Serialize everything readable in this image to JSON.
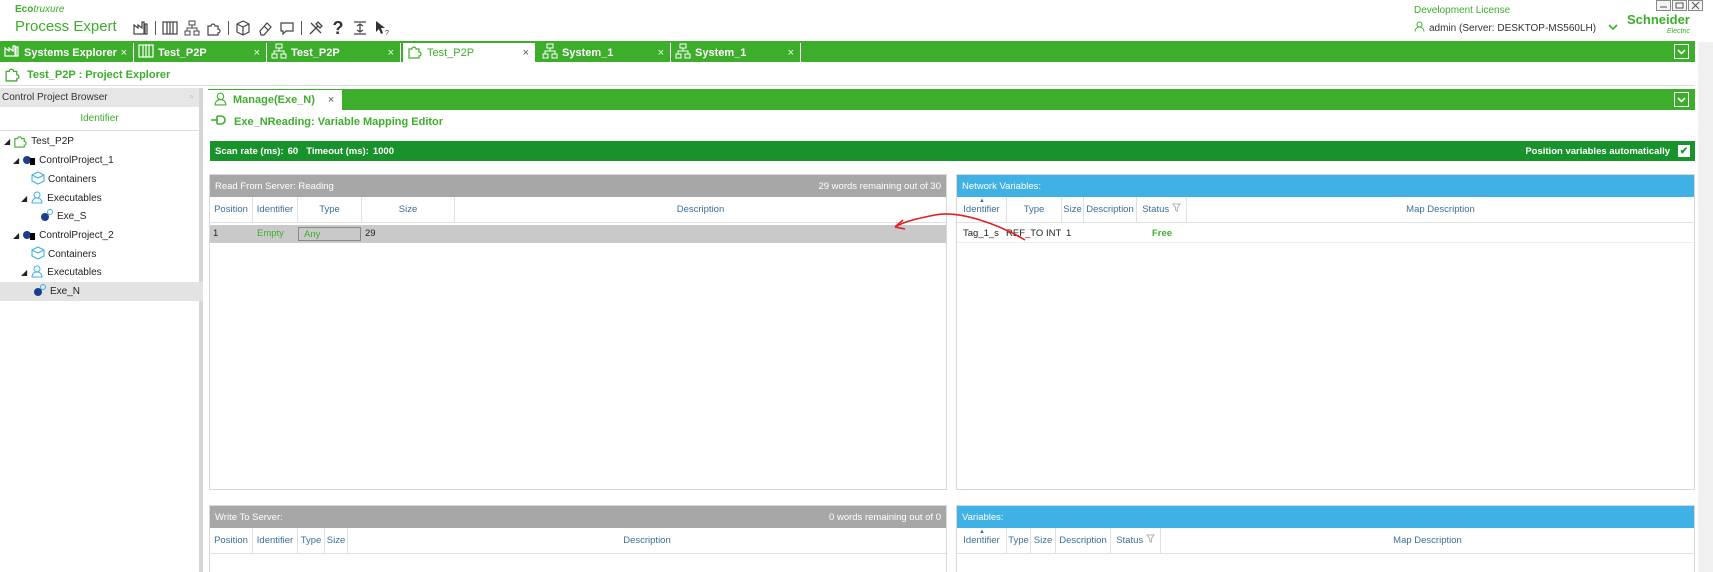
{
  "app": {
    "brand_top": "Eco",
    "brand_top_italic": "truxure",
    "brand_name": "Process Expert",
    "license": "Development License",
    "user": "admin (Server: DESKTOP-MS560LH)",
    "logo_main": "Schneider",
    "logo_sub": "Electric",
    "brand_color": "#3dae2b"
  },
  "toolbar": {
    "icons": [
      "factory-icon",
      "library-icon",
      "network-icon",
      "puzzle-icon",
      "cube-icon",
      "eraser-icon",
      "chat-icon",
      "tools-icon",
      "help-icon",
      "import-export-icon",
      "pointer-help-icon"
    ]
  },
  "tabs": [
    {
      "label": "Systems Explorer",
      "close": "×",
      "icon": "factory-icon"
    },
    {
      "label": "Test_P2P",
      "close": "×",
      "icon": "library-icon"
    },
    {
      "label": "Test_P2P",
      "close": "×",
      "icon": "network-icon"
    },
    {
      "label": "Test_P2P",
      "close": "×",
      "icon": "puzzle-icon"
    },
    {
      "label": "System_1",
      "close": "×",
      "icon": "network-icon"
    },
    {
      "label": "System_1",
      "close": "×",
      "icon": "network-icon"
    }
  ],
  "project_header": "Test_P2P : Project Explorer",
  "browser": {
    "title": "Control Project Browser",
    "column": "Identifier",
    "tree": [
      {
        "label": "Test_P2P"
      },
      {
        "label": "ControlProject_1"
      },
      {
        "label": "Containers"
      },
      {
        "label": "Executables"
      },
      {
        "label": "Exe_S"
      },
      {
        "label": "ControlProject_2"
      },
      {
        "label": "Containers"
      },
      {
        "label": "Executables"
      },
      {
        "label": "Exe_N"
      }
    ]
  },
  "editor": {
    "tab_label": "Manage(Exe_N)",
    "tab_close": "×",
    "title": "Exe_NReading: Variable Mapping Editor",
    "scan_rate_label": "Scan rate (ms):",
    "scan_rate": "60",
    "timeout_label": "Timeout (ms):",
    "timeout": "1000",
    "auto_position_label": "Position variables automatically",
    "auto_position_checked": "✔"
  },
  "read_panel": {
    "title": "Read From Server:  Reading",
    "remaining": "29 words remaining out of 30",
    "columns": [
      "Position",
      "Identifier",
      "Type",
      "Size",
      "Description"
    ],
    "row": {
      "position": "1",
      "identifier": "Empty",
      "type": "Any",
      "size": "29",
      "description": ""
    }
  },
  "network_panel": {
    "title": "Network Variables:",
    "columns": [
      "Identifier",
      "Type",
      "Size",
      "Description",
      "Status",
      "Map Description"
    ],
    "row": {
      "identifier": "Tag_1_s",
      "type": "REF_TO INT",
      "size": "1",
      "description": "",
      "status": "Free",
      "map_description": ""
    }
  },
  "write_panel": {
    "title": "Write To Server:",
    "remaining": "0 words remaining out of 0",
    "columns": [
      "Position",
      "Identifier",
      "Type",
      "Size",
      "Description"
    ]
  },
  "variables_panel": {
    "title": "Variables:",
    "columns": [
      "Identifier",
      "Type",
      "Size",
      "Description",
      "Status",
      "Map Description"
    ]
  },
  "colors": {
    "green": "#3dae2b",
    "dark_green": "#18922b",
    "blue_header": "#40b1e5",
    "gray_header": "#a7a7a7",
    "arrow": "#e02020"
  }
}
